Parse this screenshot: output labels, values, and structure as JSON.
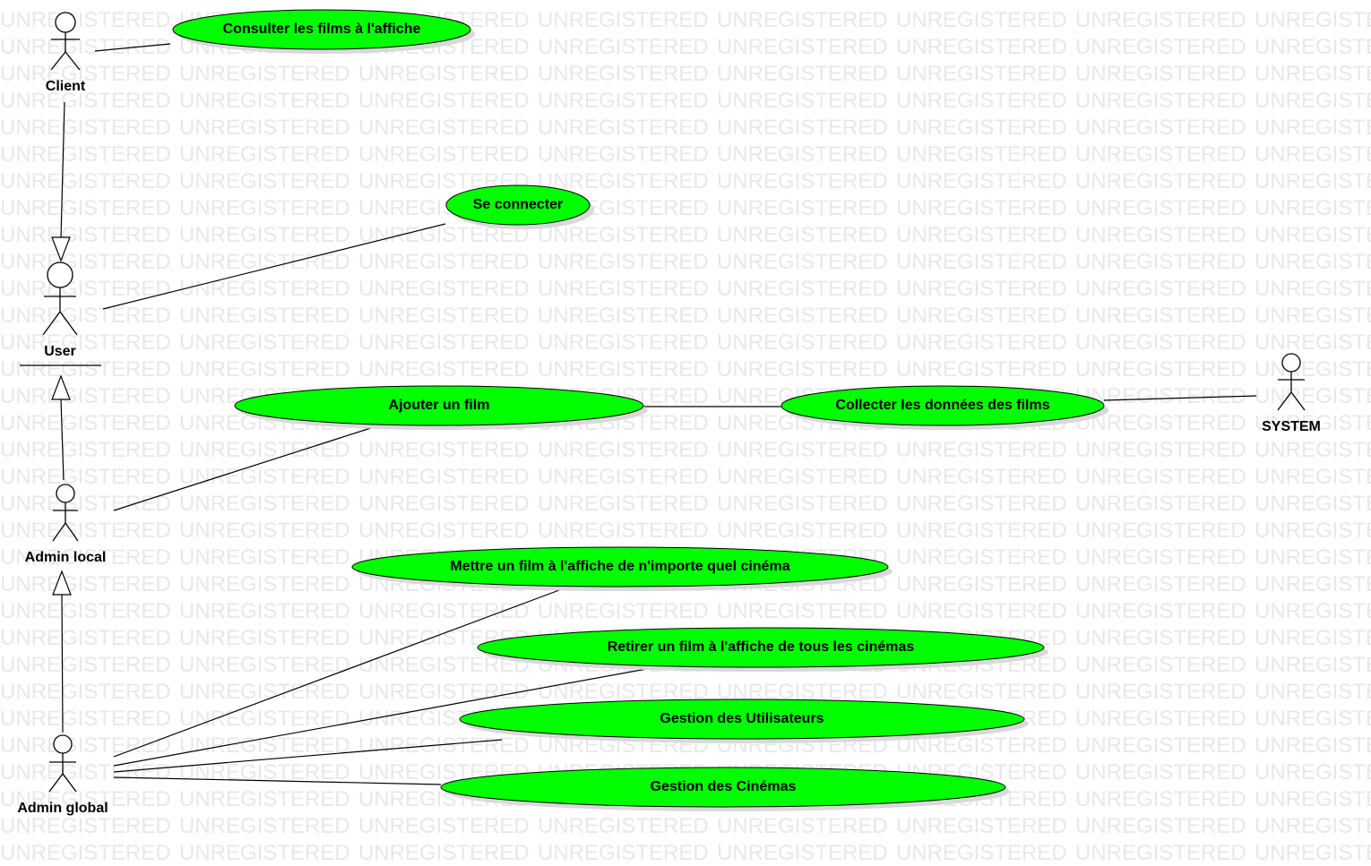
{
  "watermark_text": "UNREGISTERED",
  "colors": {
    "usecase_fill": "#00ff00",
    "watermark": "#e8e8e8",
    "line": "#000000"
  },
  "actors": {
    "client": "Client",
    "user": "User",
    "admin_local": "Admin local",
    "admin_global": "Admin global",
    "system": "SYSTEM"
  },
  "use_cases": {
    "consulter": "Consulter les films à l'affiche",
    "connecter": "Se connecter",
    "ajouter": "Ajouter un film",
    "collecter": "Collecter les données des films",
    "mettre": "Mettre un film à l'affiche de n'importe quel cinéma",
    "retirer": "Retirer un film à l'affiche de tous les cinémas",
    "utilisateurs": "Gestion des Utilisateurs",
    "cinemas": "Gestion des Cinémas"
  }
}
